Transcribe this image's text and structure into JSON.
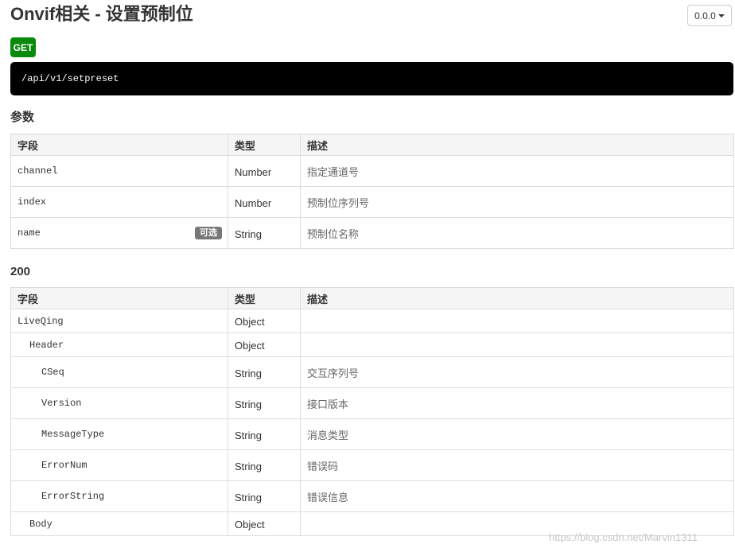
{
  "header": {
    "title": "Onvif相关 - 设置预制位",
    "version_label": "0.0.0"
  },
  "request": {
    "method": "GET",
    "url": "/api/v1/setpreset"
  },
  "params": {
    "title": "参数",
    "columns": [
      "字段",
      "类型",
      "描述"
    ],
    "rows": [
      {
        "field": "channel",
        "type": "Number",
        "desc": "指定通道号",
        "optional": ""
      },
      {
        "field": "index",
        "type": "Number",
        "desc": "预制位序列号",
        "optional": ""
      },
      {
        "field": "name",
        "type": "String",
        "desc": "预制位名称",
        "optional": "可选"
      }
    ]
  },
  "response": {
    "title": "200",
    "columns": [
      "字段",
      "类型",
      "描述"
    ],
    "rows": [
      {
        "field": "LiveQing",
        "type": "Object",
        "desc": ""
      },
      {
        "field": "Header",
        "type": "Object",
        "desc": ""
      },
      {
        "field": "CSeq",
        "type": "String",
        "desc": "交互序列号"
      },
      {
        "field": "Version",
        "type": "String",
        "desc": "接口版本"
      },
      {
        "field": "MessageType",
        "type": "String",
        "desc": "消息类型"
      },
      {
        "field": "ErrorNum",
        "type": "String",
        "desc": "错误码"
      },
      {
        "field": "ErrorString",
        "type": "String",
        "desc": "错误信息"
      },
      {
        "field": "Body",
        "type": "Object",
        "desc": ""
      }
    ]
  },
  "watermark": "https://blog.csdn.net/Marvin1311",
  "colors": {
    "method_badge": "#0a8a0a",
    "url_bar": "#000000",
    "optional_badge": "#777777",
    "table_header_bg": "#f5f5f5",
    "border": "#dddddd"
  }
}
